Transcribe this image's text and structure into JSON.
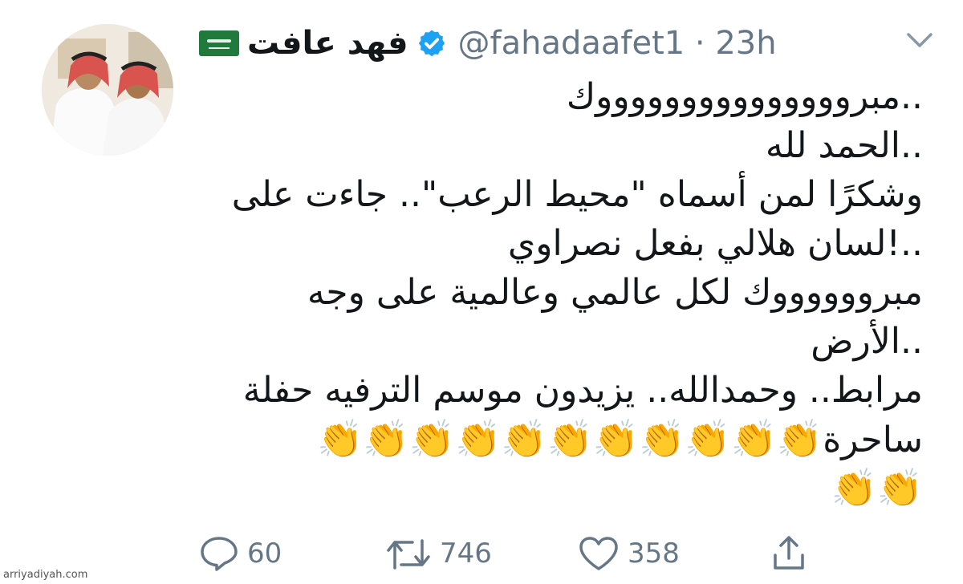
{
  "user": {
    "display_name": "فهد عافت",
    "flag_icon": "saudi-flag-icon",
    "verified_icon": "verified-badge-icon",
    "handle_time": "@fahadaafet1 · 23h"
  },
  "tweet": {
    "lines": [
      "..مبروووووووووووووووك",
      "..الحمد لله",
      "وشكرًا لمن أسماه \"محيط الرعب\".. جاءت على",
      "..!لسان هلالي بفعل نصراوي",
      "مبرووووووك لكل عالمي وعالمية على وجه",
      "..الأرض",
      "مرابط.. وحمدالله.. يزيدون موسم الترفيه حفلة"
    ],
    "line8_text": "ساحرة",
    "line8_claps": "👏👏👏👏👏👏👏👏👏👏👏",
    "line9_claps": "👏👏"
  },
  "actions": {
    "reply_count": "60",
    "retweet_count": "746",
    "like_count": "358"
  },
  "watermark": "arriyadiyah.com",
  "colors": {
    "text": "#14171a",
    "muted": "#657786",
    "verified": "#1da1f2",
    "flag": "#1f7a3c"
  }
}
